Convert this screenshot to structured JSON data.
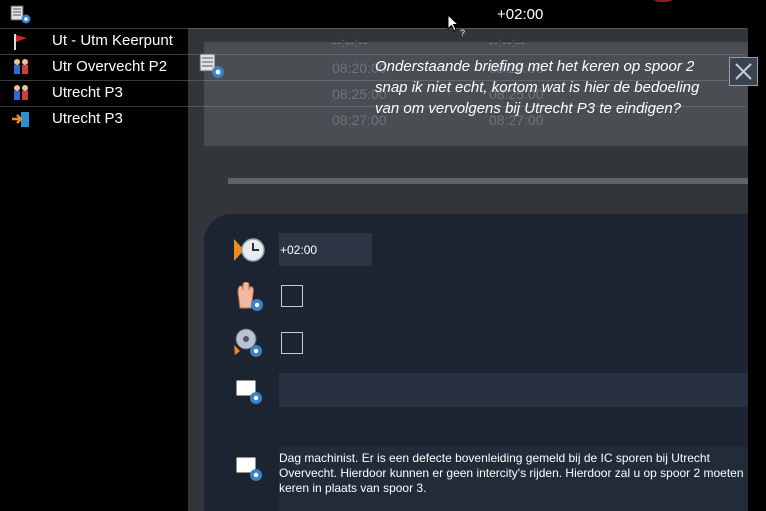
{
  "topbar": {
    "time": "+02:00"
  },
  "stops": [
    {
      "name": "Ut - Utm Keerpunt",
      "arrival": "--:--:--",
      "departure": "--:--:--",
      "icon": "red-flag-icon"
    },
    {
      "name": "Utr Overvecht P2",
      "arrival": "08:20:00",
      "departure": "08:20:00",
      "icon": "passengers-icon"
    },
    {
      "name": "Utrecht P3",
      "arrival": "08:25:00",
      "departure": "08:25:00",
      "icon": "passengers-icon"
    },
    {
      "name": "Utrecht P3",
      "arrival": "08:27:00",
      "departure": "08:27:00",
      "icon": "arrival-door-icon"
    }
  ],
  "dialog": {
    "question": "Onderstaande briefing met het keren op spoor 2 snap ik niet echt, kortom wat is hier de bedoeling van om vervolgens bij Utrecht P3 te eindigen?",
    "delay": "+02:00",
    "message": "Dag machinist. Er is een defecte bovenleiding gemeld bij de IC sporen bij Utrecht Overvecht. Hierdoor kunnen er geen intercity's rijden. Hierdoor zal u op spoor 2 moeten keren in plaats van spoor 3."
  }
}
